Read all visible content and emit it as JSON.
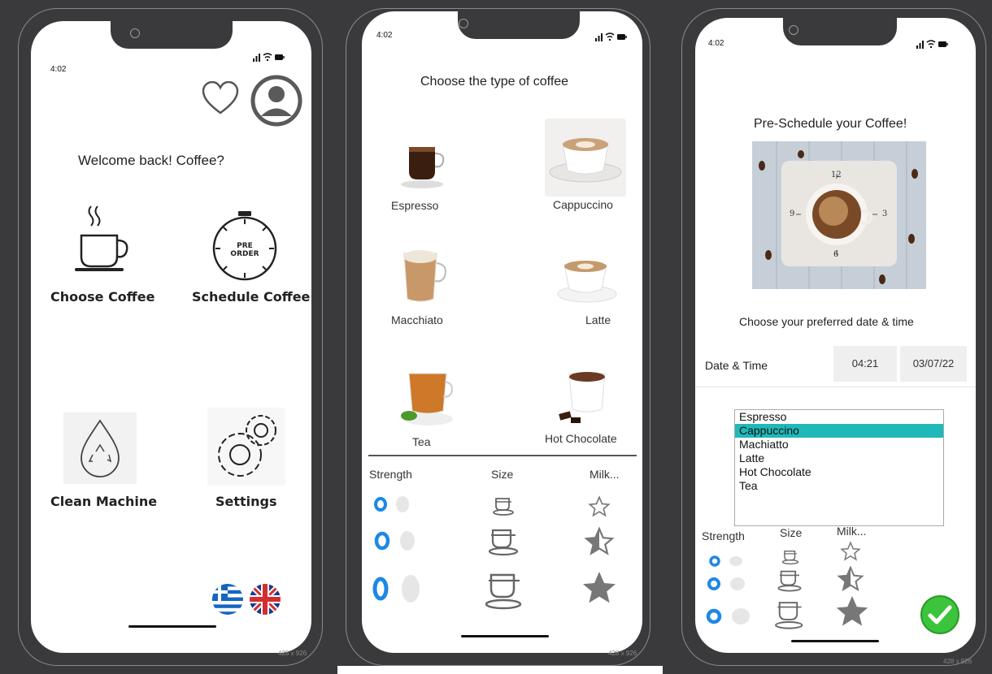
{
  "phone1": {
    "time": "4:02",
    "signal_text": "·ıl ≈ ▬",
    "welcome": "Welcome back! Coffee?",
    "tiles": {
      "choose_coffee": "Choose Coffee",
      "schedule_coffee": "Schedule Coffee",
      "pre_order_badge_line1": "PRE",
      "pre_order_badge_line2": "ORDER",
      "clean_machine": "Clean Machine",
      "settings": "Settings"
    },
    "size_tag": "428 x 926"
  },
  "phone2": {
    "time": "4:02",
    "signal_text": "·ıl ≈ ▬",
    "heading": "Choose the type of coffee",
    "drinks": [
      "Espresso",
      "Cappuccino",
      "Macchiato",
      "Latte",
      "Tea",
      "Hot Chocolate"
    ],
    "options": {
      "strength": "Strength",
      "size": "Size",
      "milk": "Milk..."
    },
    "size_tag": "428 x 926"
  },
  "phone3": {
    "time": "4:02",
    "signal_text": "·ıl ≈ ▬",
    "heading": "Pre-Schedule your Coffee!",
    "clock_numbers": [
      "12",
      "3",
      "6",
      "9"
    ],
    "subheading": "Choose your preferred date & time",
    "date_time_label": "Date & Time",
    "time_value": "04:21",
    "date_value": "03/07/22",
    "drink_list": [
      "Espresso",
      "Cappuccino",
      "Machiatto",
      "Latte",
      "Hot Chocolate",
      "Tea"
    ],
    "selected_drink": "Cappuccino",
    "options": {
      "strength": "Strength",
      "size": "Size",
      "milk": "Milk..."
    },
    "size_tag": "428 x 926"
  },
  "colors": {
    "accent_blue": "#1e88e5",
    "selection_teal": "#21b8b8",
    "confirm_green": "#3cc43c",
    "star_gray": "#777777"
  }
}
